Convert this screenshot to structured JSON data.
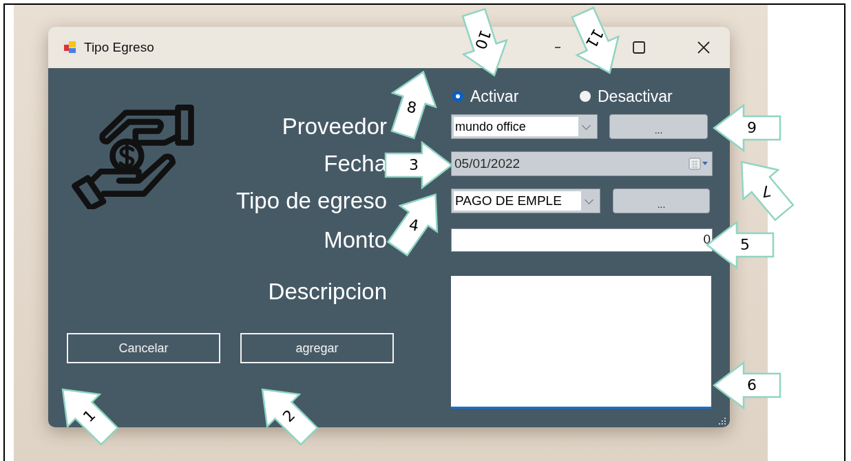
{
  "window": {
    "title": "Tipo Egreso"
  },
  "status": [
    {
      "label": "Activar",
      "selected": true
    },
    {
      "label": "Desactivar",
      "selected": false
    }
  ],
  "labels": [
    "Proveedor",
    "Fecha",
    "Tipo de egreso",
    "Monto",
    "Descripcion"
  ],
  "proveedor": {
    "value": "mundo office",
    "button": "..."
  },
  "fecha": {
    "value": "05/01/2022"
  },
  "tipo_egreso": {
    "value": "PAGO DE EMPLE",
    "button": "..."
  },
  "monto": {
    "value": "0"
  },
  "buttons": [
    "Cancelar",
    "agregar"
  ],
  "callouts": [
    {
      "label": "10"
    },
    {
      "label": "11"
    },
    {
      "label": "8"
    },
    {
      "label": "3"
    },
    {
      "label": "4"
    },
    {
      "label": "9"
    },
    {
      "label": "7"
    },
    {
      "label": "5"
    },
    {
      "label": "6"
    },
    {
      "label": "1"
    },
    {
      "label": "2"
    }
  ]
}
